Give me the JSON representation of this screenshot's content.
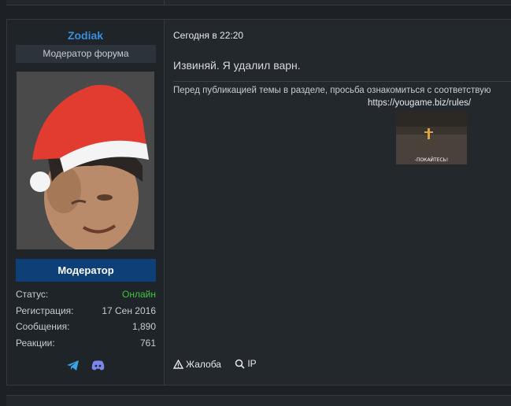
{
  "user": {
    "name": "Zodiak",
    "title": "Модератор форума",
    "role": "Модератор",
    "colors": {
      "name": "#3b8ede",
      "role_bg": "#0e3f77",
      "online": "#3fc43f"
    },
    "stats": [
      {
        "label": "Статус:",
        "value": "Онлайн"
      },
      {
        "label": "Регистрация:",
        "value": "17 Сен 2016"
      },
      {
        "label": "Сообщения:",
        "value": "1,890"
      },
      {
        "label": "Реакции:",
        "value": "761"
      }
    ],
    "social": [
      "telegram-icon",
      "discord-icon"
    ]
  },
  "post": {
    "date": "Сегодня в 22:20",
    "body": "Извиняй. Я удалил варн.",
    "signature": {
      "text": "Перед публикацией темы в разделе, просьба ознакомиться с соответствую",
      "link": "https://yougame.biz/rules/",
      "gif_caption": "-ПОКАЙТЕСЬ!"
    },
    "actions": {
      "report": "Жалоба",
      "ip": "IP"
    }
  }
}
